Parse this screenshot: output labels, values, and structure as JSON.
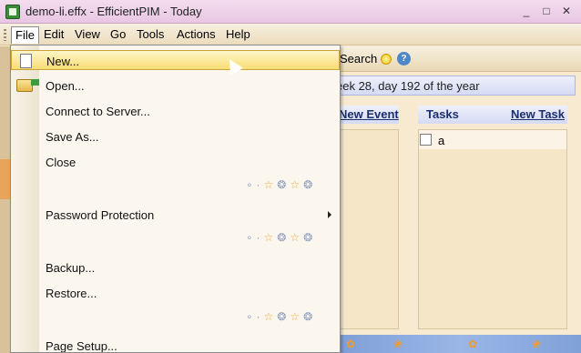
{
  "window": {
    "title": "demo-li.effx - EfficientPIM - Today",
    "buttons": [
      "_",
      "□",
      "✕"
    ]
  },
  "menubar": {
    "items": [
      "File",
      "Edit",
      "View",
      "Go",
      "Tools",
      "Actions",
      "Help"
    ]
  },
  "toolbar": {
    "search_label": "Search"
  },
  "datebar": {
    "text": "eek 28, day 192 of the year"
  },
  "events": {
    "new_event_label": "New Event"
  },
  "tasks": {
    "header": "Tasks",
    "new_task_label": "New Task",
    "items": [
      {
        "label": "a",
        "checked": false
      }
    ]
  },
  "file_menu": {
    "items": [
      {
        "label": "New...",
        "highlighted": true
      },
      {
        "label": "Open..."
      },
      {
        "label": "Connect to Server..."
      },
      {
        "label": "Save As..."
      },
      {
        "label": "Close"
      },
      {
        "label": "Password Protection",
        "submenu": true
      },
      {
        "label": "Backup..."
      },
      {
        "label": "Restore..."
      },
      {
        "label": "Page Setup..."
      }
    ]
  },
  "colors": {
    "highlight": "#f8dd74",
    "title_bar": "#e9c6e3",
    "date_bar": "#d5dbf4",
    "content_bg": "#f5e6c8"
  }
}
